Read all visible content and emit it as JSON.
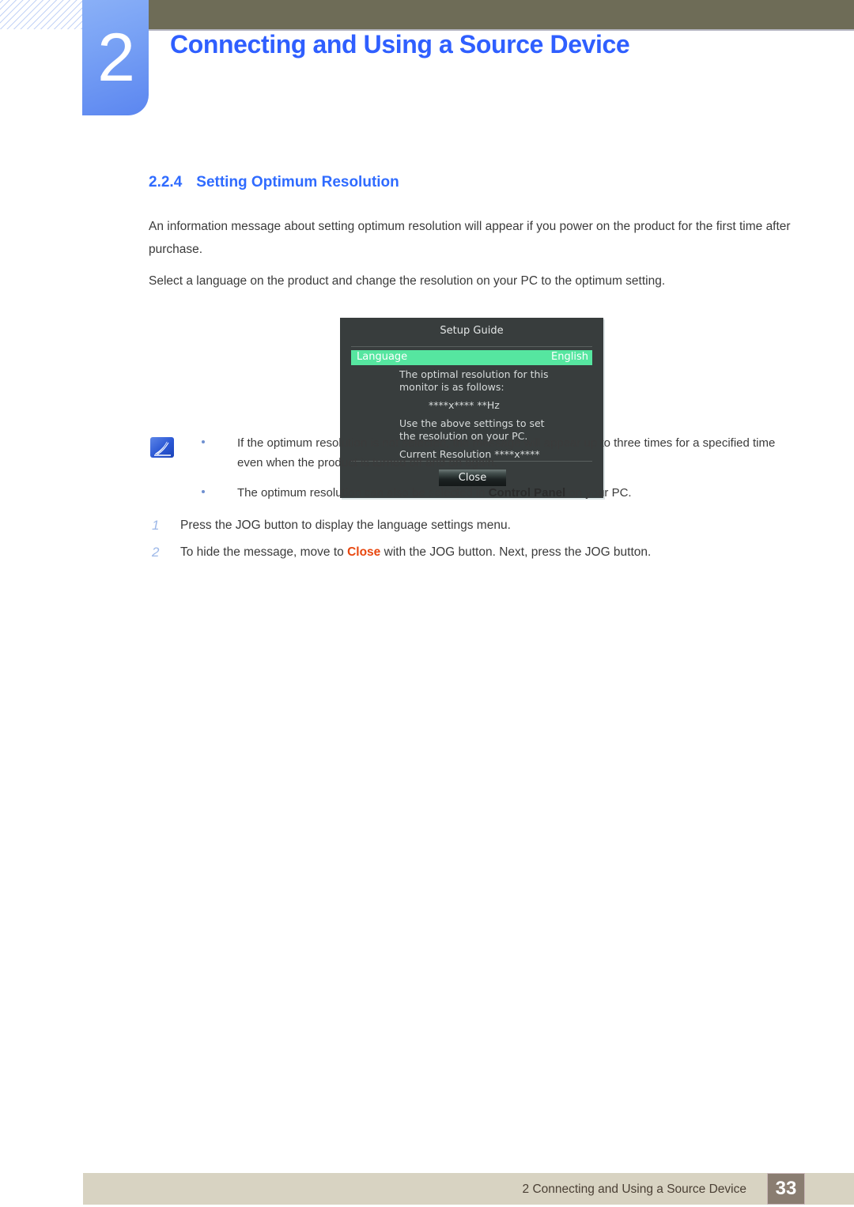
{
  "header": {
    "chapter_number": "2",
    "chapter_title": "Connecting and Using a Source Device",
    "accent_blue": "#2f5fff",
    "bar_color": "#6e6c57"
  },
  "section": {
    "number": "2.2.4",
    "title": "Setting Optimum Resolution",
    "paragraphs": [
      "An information message about setting optimum resolution will appear if you power on the product for the first time after purchase.",
      "Select a language on the product and change the resolution on your PC to the optimum setting."
    ]
  },
  "osd": {
    "title": "Setup Guide",
    "language_label": "Language",
    "language_value": "English",
    "highlight_color": "#56e6a0",
    "background_color": "#383d3d",
    "line_1": "The optimal resolution for this",
    "line_2": "monitor is as follows:",
    "resolution": "****x**** **Hz",
    "line_3": "Use the above settings to set",
    "line_4": "the resolution on your PC.",
    "current_resolution": "Current Resolution ****x****",
    "close_label": "Close"
  },
  "steps": [
    {
      "number": "1",
      "text_before": "Press the JOG button to display the language settings menu.",
      "keyword": "",
      "text_after": ""
    },
    {
      "number": "2",
      "text_before": "To hide the message, move to ",
      "keyword": "Close",
      "text_after": " with the JOG button. Next, press the JOG button."
    }
  ],
  "note": {
    "icon": "note-pen-icon",
    "items": [
      {
        "text_before": "If the optimum resolution is not selected, the message will appear up to three times for a specified time even when the product is turned off and on again.",
        "keyword": "",
        "text_after": ""
      },
      {
        "text_before": "The optimum resolution can also be selected in ",
        "keyword": "Control Panel",
        "text_after": " on your PC."
      }
    ]
  },
  "footer": {
    "text": "2 Connecting and Using a Source Device",
    "page_number": "33",
    "bar_color": "#d8d3c2",
    "pageno_color": "#8a7d71"
  }
}
